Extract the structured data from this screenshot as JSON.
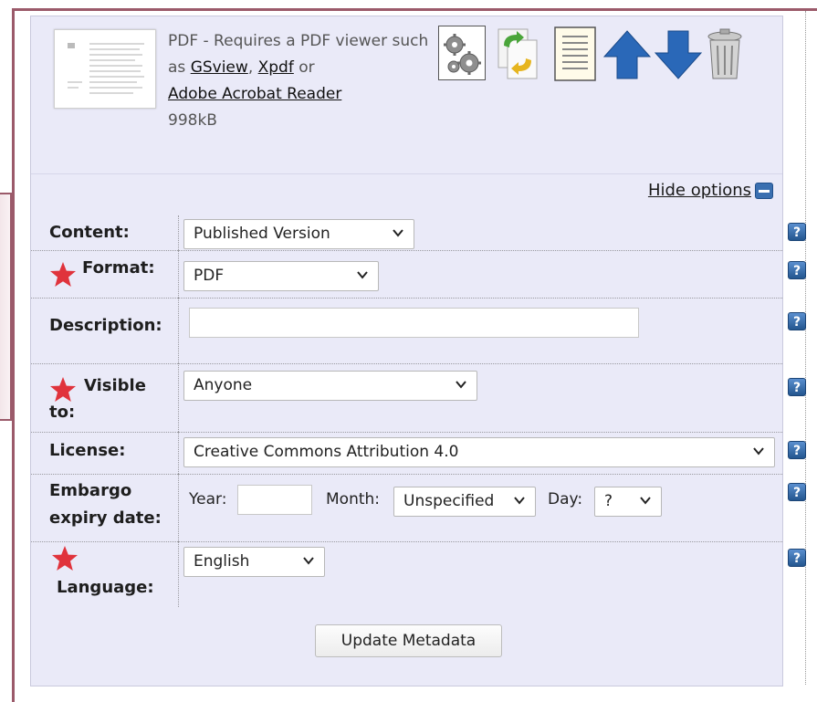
{
  "file": {
    "description_line": "PDF - Requires a PDF viewer such as",
    "viewers": [
      "GSview",
      "Xpdf",
      "Adobe Acrobat Reader"
    ],
    "separator": ",",
    "or_text": "or",
    "size": "998kB"
  },
  "toolbar": {
    "icons": [
      "gears-icon",
      "convert-icon",
      "text-document-icon",
      "arrow-up-icon",
      "arrow-down-icon",
      "trash-icon"
    ]
  },
  "hide_options_label": "Hide options",
  "fields": {
    "content": {
      "label": "Content:",
      "value": "Published Version"
    },
    "format": {
      "label": "Format:",
      "value": "PDF"
    },
    "description": {
      "label": "Description:",
      "value": ""
    },
    "visible_to": {
      "label_line1": "Visible",
      "label_line2": "to:",
      "value": "Anyone"
    },
    "license": {
      "label": "License:",
      "value": "Creative Commons Attribution 4.0"
    },
    "embargo": {
      "label_line1": "Embargo",
      "label_line2": "expiry date:",
      "year_label": "Year:",
      "year_value": "",
      "month_label": "Month:",
      "month_value": "Unspecified",
      "day_label": "Day:",
      "day_value": "?"
    },
    "language": {
      "label": "Language:",
      "value": "English"
    }
  },
  "help_symbol": "?",
  "update_button_label": "Update Metadata",
  "colors": {
    "accent_border": "#9b5a6a",
    "panel_bg": "#eaeaf8",
    "help_blue": "#2f67a8",
    "required_star": "#e0333c"
  }
}
